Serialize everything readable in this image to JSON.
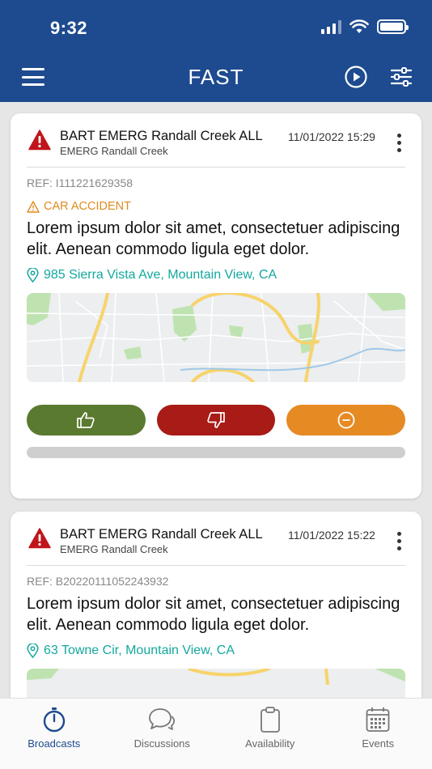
{
  "status_bar": {
    "time": "9:32"
  },
  "header": {
    "title": "FAST"
  },
  "cards": [
    {
      "title": "BART  EMERG Randall Creek ALL",
      "subtitle": "EMERG Randall Creek",
      "datetime": "11/01/2022 15:29",
      "ref": "REF: I111221629358",
      "incident_type": "CAR ACCIDENT",
      "body": "Lorem ipsum dolor sit amet, consectetuer adipiscing elit. Aenean commodo ligula eget dolor.",
      "address": "985 Sierra Vista Ave, Mountain View, CA"
    },
    {
      "title": "BART  EMERG Randall Creek ALL",
      "subtitle": "EMERG Randall Creek",
      "datetime": "11/01/2022 15:22",
      "ref": "REF: B20220111052243932",
      "body": "Lorem ipsum dolor sit amet, consectetuer adipiscing elit. Aenean commodo ligula eget dolor.",
      "address": "63 Towne Cir, Mountain View, CA"
    }
  ],
  "tabs": [
    {
      "label": "Broadcasts",
      "icon": "stopwatch-icon"
    },
    {
      "label": "Discussions",
      "icon": "chat-bubbles-icon"
    },
    {
      "label": "Availability",
      "icon": "clipboard-icon"
    },
    {
      "label": "Events",
      "icon": "calendar-icon"
    }
  ],
  "colors": {
    "header_bg": "#1e4b8f",
    "accept": "#5a7a2f",
    "decline": "#a81b16",
    "neutral": "#e68a24",
    "alert": "#c0161b",
    "incident_type": "#e08a1e",
    "address": "#13a89e"
  }
}
